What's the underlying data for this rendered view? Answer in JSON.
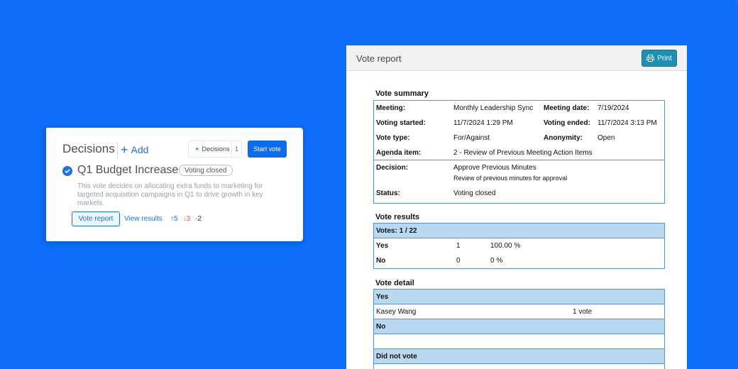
{
  "decisions_card": {
    "title": "Decisions",
    "add_label": "Add",
    "chip_label": "Decisions",
    "chip_count": "1",
    "start_vote_label": "Start vote",
    "decision_title": "Q1 Budget Increase",
    "status": "Voting closed",
    "description": "This vote decides on allocating extra funds to marketing for targeted acquisition campaigns in Q1 to drive growth in key markets.",
    "vote_report_label": "Vote report",
    "view_results_label": "View results",
    "count_up": "↑5",
    "count_down": "↓3",
    "count_other": "·2"
  },
  "report": {
    "title": "Vote report",
    "print_label": "Print",
    "summary": {
      "heading": "Vote summary",
      "meeting_label": "Meeting:",
      "meeting_value": "Monthly Leadership Sync",
      "meeting_date_label": "Meeting date:",
      "meeting_date_value": "7/19/2024",
      "voting_started_label": "Voting started:",
      "voting_started_value": "11/7/2024 1:29 PM",
      "voting_ended_label": "Voting ended:",
      "voting_ended_value": "11/7/2024 3:13 PM",
      "vote_type_label": "Vote type:",
      "vote_type_value": "For/Against",
      "anonymity_label": "Anonymity:",
      "anonymity_value": "Open",
      "agenda_label": "Agenda item:",
      "agenda_value": "2 - Review of Previous Meeting Action Items",
      "decision_label": "Decision:",
      "decision_value": "Approve Previous Minutes",
      "decision_sub": "Review of previous minutes for approval",
      "status_label": "Status:",
      "status_value": "Voting closed"
    },
    "results": {
      "heading": "Vote results",
      "votes_header": "Votes: 1 / 22",
      "rows": [
        {
          "option": "Yes",
          "count": "1",
          "percent": "100.00 %"
        },
        {
          "option": "No",
          "count": "0",
          "percent": "0 %"
        }
      ]
    },
    "detail": {
      "heading": "Vote detail",
      "yes_header": "Yes",
      "yes_voter": "Kasey Wang",
      "yes_votes": "1 vote",
      "no_header": "No",
      "did_not_vote_header": "Did not vote"
    }
  },
  "colors": {
    "background": "#0a6cf7",
    "accent": "#1a73e8",
    "print_button": "#1f8fb3",
    "table_header": "#b9d9f1"
  }
}
